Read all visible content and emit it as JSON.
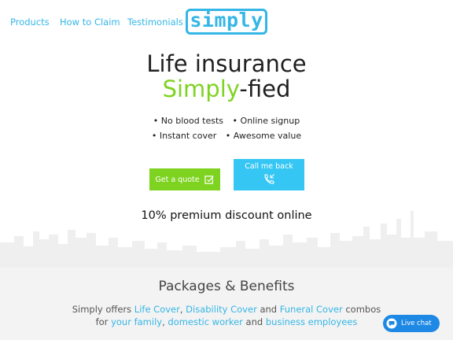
{
  "nav": {
    "links": [
      "Products",
      "How to Claim",
      "Testimonials"
    ],
    "logo": "simply"
  },
  "hero": {
    "line1": "Life insurance",
    "line2_accent": "Simply",
    "line2_rest": "-fied"
  },
  "bullets": {
    "row1": [
      "• No blood tests",
      "• Online signup"
    ],
    "row2": [
      "• Instant cover",
      "• Awesome value"
    ]
  },
  "buttons": {
    "quote": "Get a quote",
    "call": "Call me back"
  },
  "discount": "10% premium discount online",
  "packages": {
    "title": "Packages & Benefits",
    "line1": {
      "pre": "Simply offers ",
      "life": "Life Cover",
      "sep1": ", ",
      "disability": "Disability Cover",
      "sep2": " and ",
      "funeral": "Funeral Cover",
      "post": " combos"
    },
    "line2": {
      "pre": "for ",
      "family": "your family",
      "sep1": ", ",
      "domestic": "domestic worker",
      "sep2": " and ",
      "business": "business employees"
    }
  },
  "livechat": "Live chat",
  "colors": {
    "brand_blue": "#35b6e6",
    "accent_green": "#7ed321",
    "call_blue": "#35c6f4",
    "chat_blue": "#1e88e5"
  },
  "icons": [
    "checkbox-edit-icon",
    "phone-callback-icon",
    "chat-bubble-icon"
  ]
}
